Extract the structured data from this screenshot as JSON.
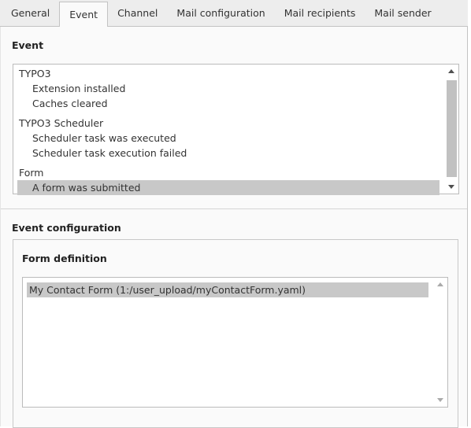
{
  "tabs": [
    {
      "label": "General"
    },
    {
      "label": "Event",
      "active": true
    },
    {
      "label": "Channel"
    },
    {
      "label": "Mail configuration"
    },
    {
      "label": "Mail recipients"
    },
    {
      "label": "Mail sender"
    }
  ],
  "event": {
    "heading": "Event",
    "options": [
      {
        "label": "TYPO3",
        "type": "group"
      },
      {
        "label": "Extension installed",
        "type": "child"
      },
      {
        "label": "Caches cleared",
        "type": "child"
      },
      {
        "label": "TYPO3 Scheduler",
        "type": "group"
      },
      {
        "label": "Scheduler task was executed",
        "type": "child"
      },
      {
        "label": "Scheduler task execution failed",
        "type": "child"
      },
      {
        "label": "Form",
        "type": "group"
      },
      {
        "label": "A form was submitted",
        "type": "child",
        "selected": true
      }
    ]
  },
  "event_configuration": {
    "heading": "Event configuration",
    "form_definition": {
      "heading": "Form definition",
      "options": [
        {
          "label": "My Contact Form (1:/user_upload/myContactForm.yaml)",
          "selected": true
        }
      ]
    }
  }
}
